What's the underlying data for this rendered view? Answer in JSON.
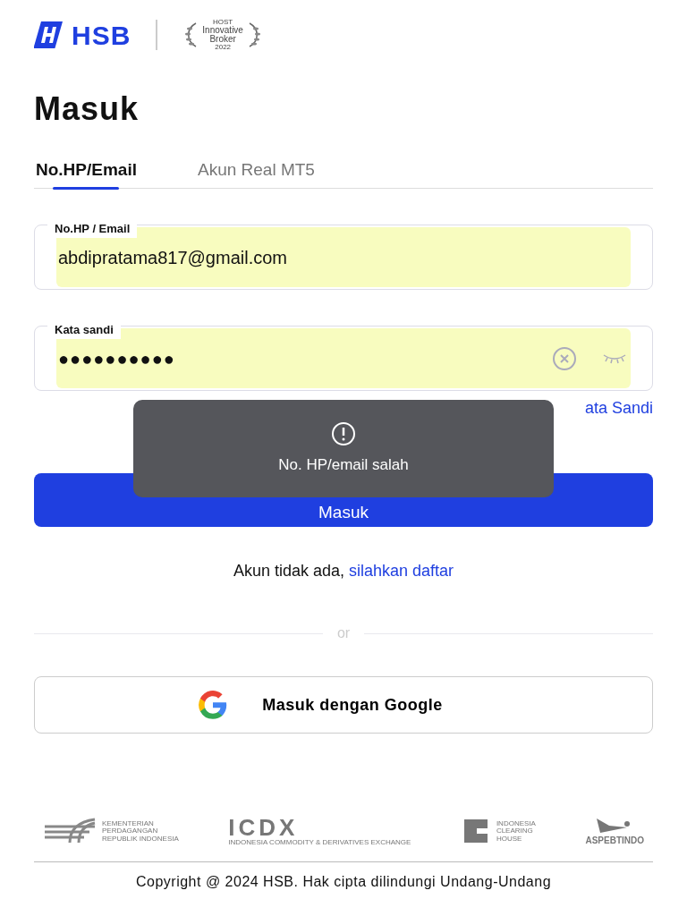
{
  "header": {
    "brand": "HSB",
    "award": {
      "top": "HOST",
      "title": "Innovative",
      "subtitle": "Broker",
      "year": "2022"
    }
  },
  "title": "Masuk",
  "tabs": [
    {
      "label": "No.HP/Email",
      "selected": true
    },
    {
      "label": "Akun Real MT5",
      "selected": false
    }
  ],
  "fields": [
    {
      "kind": "text",
      "label": "No.HP / Email",
      "value": "abdipratama817@gmail.com",
      "autofilled": true
    },
    {
      "kind": "password",
      "label": "Kata sandi",
      "value": "●●●●●●●●●●",
      "autofilled": true
    }
  ],
  "forgot_link": "ata Sandi",
  "submit_button": "Masuk",
  "register": {
    "text": "Akun tidak ada,",
    "link": "silahkan daftar"
  },
  "divider": "or",
  "google_button": "Masuk dengan Google",
  "partners": [
    {
      "kind": "kemendag",
      "lines": [
        "KEMENTERIAN",
        "PERDAGANGAN",
        "REPUBLIK INDONESIA"
      ]
    },
    {
      "kind": "icdx",
      "lines": [
        "ICDX",
        "INDONESIA COMMODITY & DERIVATIVES EXCHANGE"
      ]
    },
    {
      "kind": "ich",
      "lines": [
        "INDONESIA",
        "CLEARING",
        "HOUSE"
      ]
    },
    {
      "kind": "aspebtindo",
      "lines": [
        "ASPEBTINDO"
      ]
    }
  ],
  "copyright": "Copyright @ 2024 HSB. Hak cipta dilindungi Undang-Undang",
  "toast": {
    "message": "No. HP/email salah"
  }
}
